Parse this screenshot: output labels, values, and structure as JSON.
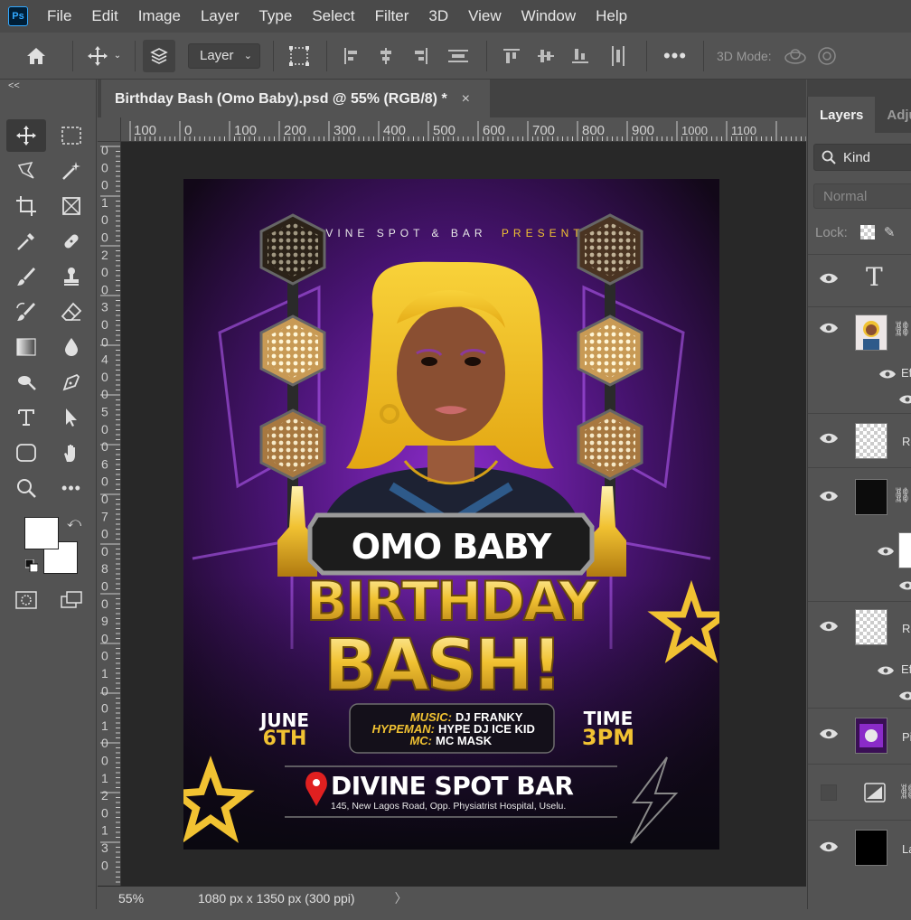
{
  "app": {
    "logo": "Ps"
  },
  "menu": [
    "File",
    "Edit",
    "Image",
    "Layer",
    "Type",
    "Select",
    "Filter",
    "3D",
    "View",
    "Window",
    "Help"
  ],
  "options": {
    "layer_select": "Layer",
    "mode_3d": "3D Mode:"
  },
  "toolbox": {
    "collapse": "<<"
  },
  "document": {
    "tab_title": "Birthday Bash (Omo Baby).psd @ 55% (RGB/8) *",
    "close": "×",
    "zoom": "55%",
    "doc_info": "1080 px x 1350 px (300 ppi)",
    "status_arrow": "〉"
  },
  "ruler": {
    "h_labels": [
      "100",
      "0",
      "100",
      "200",
      "300",
      "400",
      "500",
      "600",
      "700",
      "800",
      "900",
      "1000",
      "1100"
    ],
    "v_labels": [
      "0",
      "0",
      "0",
      "1",
      "0",
      "0",
      "2",
      "0",
      "0",
      "3",
      "0",
      "0",
      "4",
      "0",
      "0",
      "5",
      "0",
      "0",
      "6",
      "0",
      "0",
      "7",
      "0",
      "0",
      "8",
      "0",
      "0",
      "9",
      "0",
      "0",
      "1",
      "0",
      "0",
      "1",
      "0",
      "0",
      "1",
      "2",
      "0",
      "1",
      "3",
      "0"
    ]
  },
  "flyer": {
    "presents_left": "DIVINE SPOT & BAR",
    "presents_right": "PRESENTS",
    "name": "OMO BABY",
    "title1": "BIRTHDAY",
    "title2": "BASH!",
    "date1": "JUNE",
    "date2": "6TH",
    "time1": "TIME",
    "time2": "3PM",
    "music_k": "MUSIC:",
    "music_v": "DJ FRANKY",
    "hype_k": "HYPEMAN:",
    "hype_v": "HYPE DJ ICE KID",
    "mc_k": "MC:",
    "mc_v": "MC MASK",
    "venue": "DIVINE SPOT BAR",
    "address": "145, New Lagos Road, Opp. Physiatrist Hospital, Uselu."
  },
  "panel": {
    "tab_layers": "Layers",
    "tab_adjust": "Adju",
    "kind": "Kind",
    "blend": "Normal",
    "lock": "Lock:",
    "rows": [
      {
        "label": ""
      },
      {
        "label": ""
      },
      {
        "label": "Ef"
      },
      {
        "label": "Re"
      },
      {
        "label": ""
      },
      {
        "label": "Re"
      },
      {
        "label": "Ef"
      },
      {
        "label": "Pi"
      },
      {
        "label": ""
      },
      {
        "label": "La"
      }
    ]
  }
}
